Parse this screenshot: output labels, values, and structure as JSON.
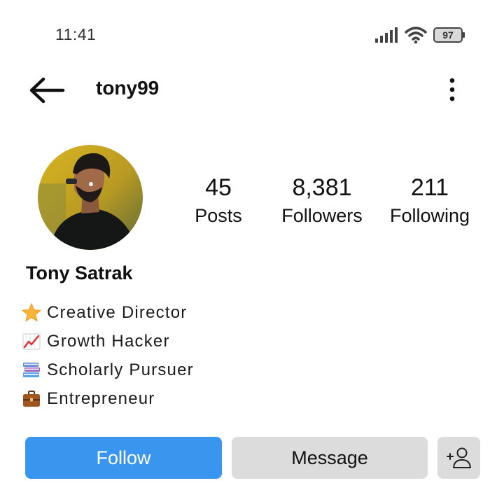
{
  "status_bar": {
    "time": "11:41",
    "battery": "97",
    "icons": [
      "signal-icon",
      "wifi-icon",
      "battery-icon"
    ]
  },
  "header": {
    "username": "tony99",
    "back_icon": "arrow-left-icon",
    "menu_icon": "more-vertical-icon"
  },
  "profile": {
    "display_name": "Tony Satrak",
    "stats": [
      {
        "value": "45",
        "label": "Posts"
      },
      {
        "value": "8,381",
        "label": "Followers"
      },
      {
        "value": "211",
        "label": "Following"
      }
    ],
    "bio": [
      {
        "icon": "star-emoji-icon",
        "text": "Creative Director"
      },
      {
        "icon": "chart-increasing-emoji-icon",
        "text": "Growth Hacker"
      },
      {
        "icon": "books-emoji-icon",
        "text": "Scholarly Pursuer"
      },
      {
        "icon": "briefcase-emoji-icon",
        "text": "Entrepreneur"
      }
    ]
  },
  "actions": {
    "follow_label": "Follow",
    "message_label": "Message",
    "add_user_icon": "add-user-icon"
  },
  "colors": {
    "accent": "#3a95ef",
    "secondary_button": "#dcdcdc"
  }
}
